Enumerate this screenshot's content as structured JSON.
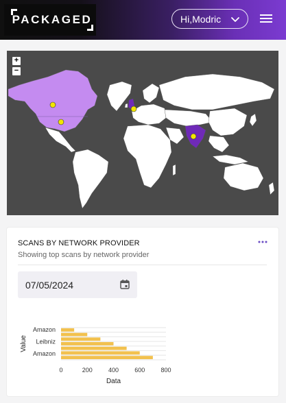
{
  "header": {
    "logo_text": "PACKAGED",
    "user_label": "Hi,Modric",
    "accent_colors": {
      "purple": "#7b3bd1",
      "dark": "#101010"
    }
  },
  "map": {
    "zoom_in_label": "+",
    "zoom_out_label": "−",
    "highlight_colors": {
      "light": "#c48bf0",
      "dark": "#6f2ab8",
      "marker": "#f2e600"
    }
  },
  "scans": {
    "title": "SCANS BY NETWORK PROVIDER",
    "subtitle": "Showing top scans by network provider",
    "date_value": "07/05/2024"
  },
  "chart_data": {
    "type": "bar",
    "orientation": "horizontal",
    "categories": [
      "Amazon",
      "",
      "Leibniz",
      "",
      "Amazon",
      ""
    ],
    "series": [
      {
        "values": [
          100,
          200,
          300,
          400,
          500,
          600,
          700
        ]
      }
    ],
    "xlabel": "Data",
    "ylabel": "Value",
    "xlim": [
      0,
      800
    ],
    "xticks": [
      "0",
      "200",
      "400",
      "600",
      "800"
    ],
    "yticks": [
      "Amazon",
      "Leibniz",
      "Amazon"
    ],
    "bar_color": "#f2c14e",
    "grid": true
  }
}
